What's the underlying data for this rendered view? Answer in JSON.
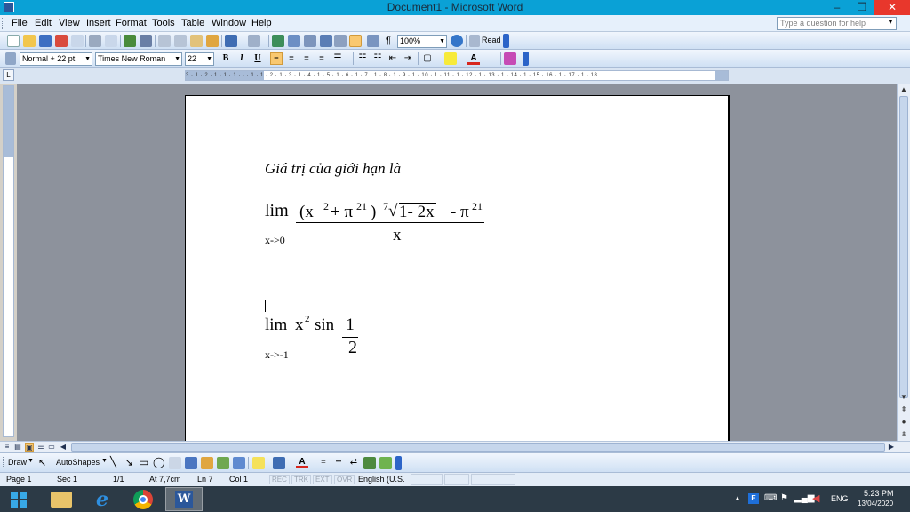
{
  "window": {
    "title": "Document1 - Microsoft Word",
    "minimize_glyph": "–",
    "restore_glyph": "❐",
    "close_glyph": "✕"
  },
  "menu": {
    "items": [
      "File",
      "Edit",
      "View",
      "Insert",
      "Format",
      "Tools",
      "Table",
      "Window",
      "Help"
    ],
    "help_placeholder": "Type a question for help"
  },
  "standard_toolbar": {
    "zoom": "100%",
    "read_label": "Read"
  },
  "formatting_toolbar": {
    "style": "Normal + 22 pt",
    "font": "Times New Roman",
    "size": "22",
    "bold": "B",
    "italic": "I",
    "underline": "U"
  },
  "document": {
    "prompt": "Giá trị của giới hạn là",
    "expr1": {
      "lim": "lim",
      "paren_open": "(x",
      "sq": "2",
      "plus_pi": "+ π",
      "exp21a": "21",
      "paren_close": ")",
      "root_index": "7",
      "radical": "√",
      "radicand": "1- 2x",
      "minus_pi": "- π",
      "exp21b": "21",
      "denominator": "x",
      "sub": "x->0"
    },
    "expr2": {
      "lim": "lim",
      "x": "x",
      "sq": "2",
      "sin": "sin",
      "numerator": "1",
      "denominator": "2",
      "sub": "x->-1"
    }
  },
  "ruler": {
    "marks": "3 · 1 · 2 · 1 · 1 · 1 · · · 1 · 1 · 2 · 1 · 3 · 1 · 4 · 1 · 5 · 1 · 6 · 1 · 7 · 1 · 8 · 1 · 9 · 1 · 10 · 1 · 11 · 1 · 12 · 1 · 13 · 1 · 14 · 1 · 15 · 16 · 1 · 17 · 1 · 18",
    "corner": "L"
  },
  "drawing_toolbar": {
    "draw_label": "Draw",
    "autoshapes_label": "AutoShapes"
  },
  "status": {
    "page": "Page 1",
    "sec": "Sec 1",
    "pages": "1/1",
    "at": "At 7,7cm",
    "ln": "Ln 7",
    "col": "Col 1",
    "rec": "REC",
    "trk": "TRK",
    "ext": "EXT",
    "ovr": "OVR",
    "language": "English (U.S."
  },
  "taskbar": {
    "lang": "ENG",
    "time": "5:23 PM",
    "date": "13/04/2020"
  },
  "colors": {
    "titlebar": "#0aa1d6",
    "close": "#e8372c",
    "workspace": "#8d929c",
    "taskbar": "#2c3a46"
  }
}
